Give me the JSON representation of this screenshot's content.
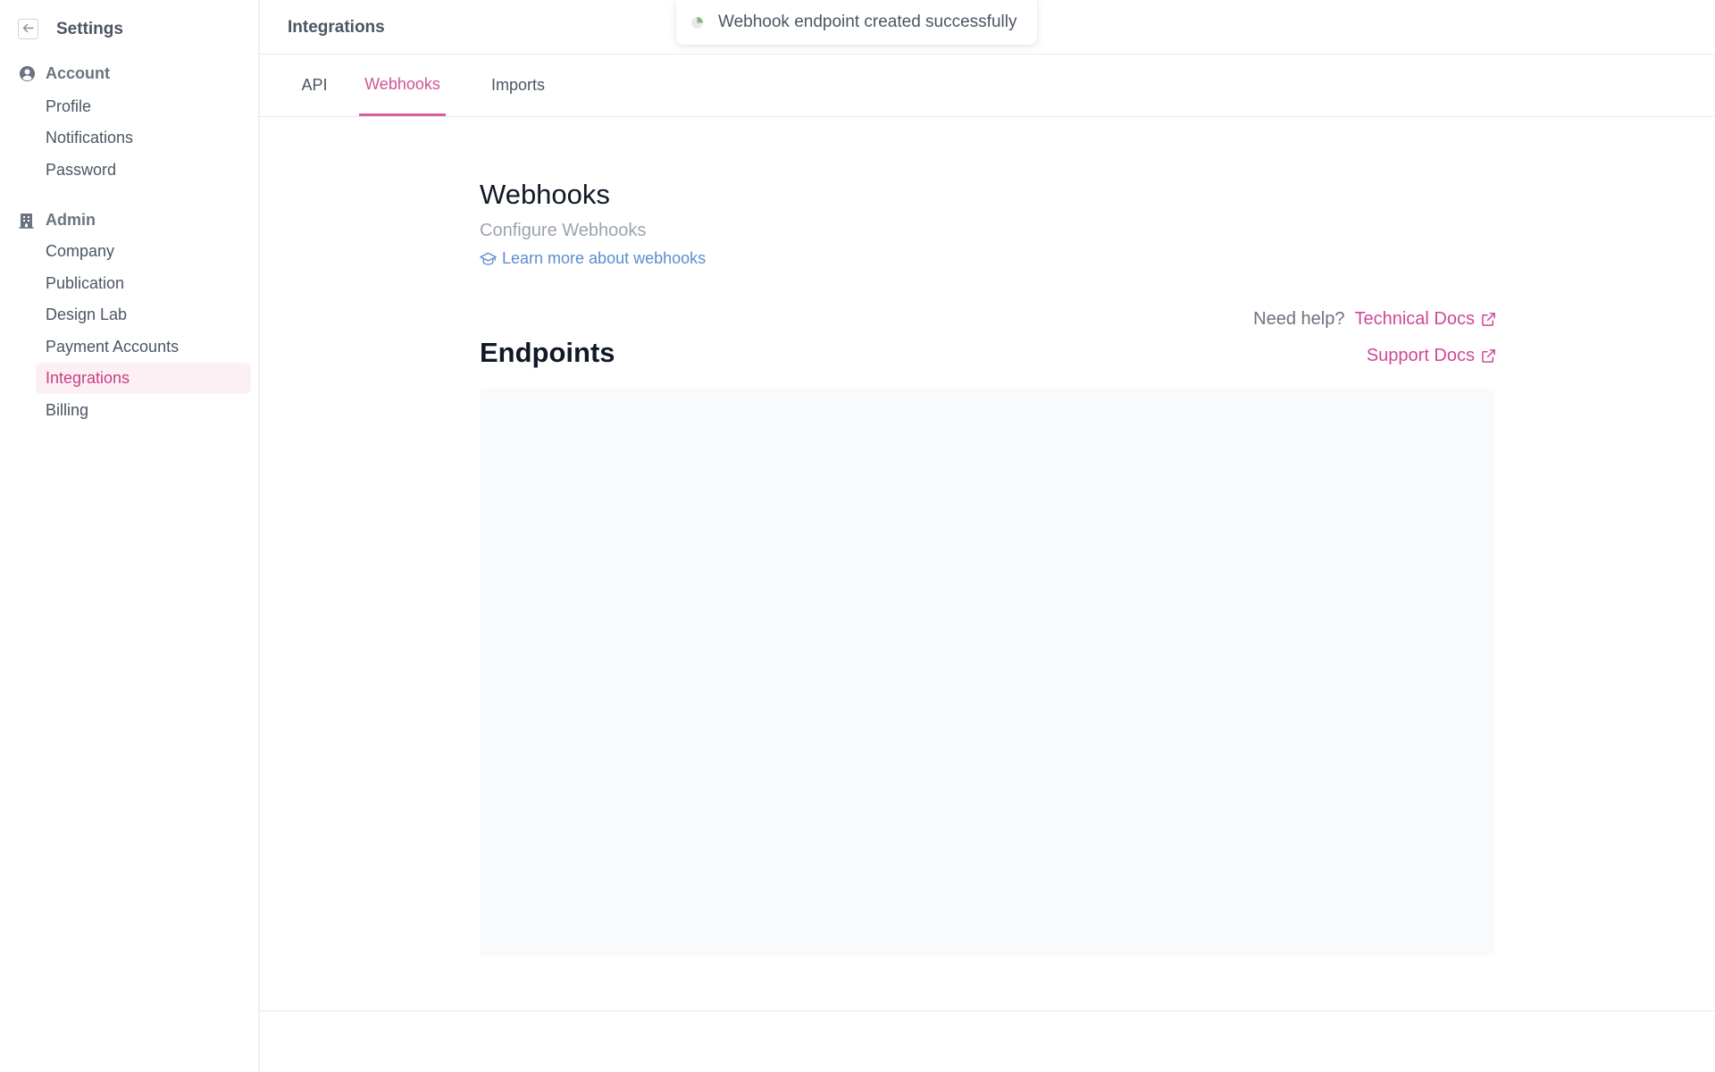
{
  "sidebar": {
    "title": "Settings",
    "back_icon": "arrow-left-icon",
    "groups": [
      {
        "title": "Account",
        "icon": "user-circle-icon",
        "items": [
          {
            "label": "Profile",
            "active": false
          },
          {
            "label": "Notifications",
            "active": false
          },
          {
            "label": "Password",
            "active": false
          }
        ]
      },
      {
        "title": "Admin",
        "icon": "building-icon",
        "items": [
          {
            "label": "Company",
            "active": false
          },
          {
            "label": "Publication",
            "active": false
          },
          {
            "label": "Design Lab",
            "active": false
          },
          {
            "label": "Payment Accounts",
            "active": false
          },
          {
            "label": "Integrations",
            "active": true
          },
          {
            "label": "Billing",
            "active": false
          }
        ]
      }
    ]
  },
  "header": {
    "title": "Integrations"
  },
  "toast": {
    "message": "Webhook endpoint created successfully",
    "icon": "loading-spinner-icon"
  },
  "tabs": [
    {
      "label": "API",
      "active": false
    },
    {
      "label": "Webhooks",
      "active": true
    },
    {
      "label": "Imports",
      "active": false
    }
  ],
  "content": {
    "title": "Webhooks",
    "subtitle": "Configure Webhooks",
    "learn_link": "Learn more about webhooks",
    "learn_icon": "graduation-cap-icon",
    "help_label": "Need help?",
    "technical_docs": "Technical Docs",
    "support_docs": "Support Docs",
    "external_icon": "external-link-icon",
    "endpoints_title": "Endpoints"
  },
  "colors": {
    "accent": "#d0479a",
    "active_bg": "#fdf0f5",
    "link_blue": "#5b8dd0",
    "panel_bg": "#f9fafb"
  }
}
